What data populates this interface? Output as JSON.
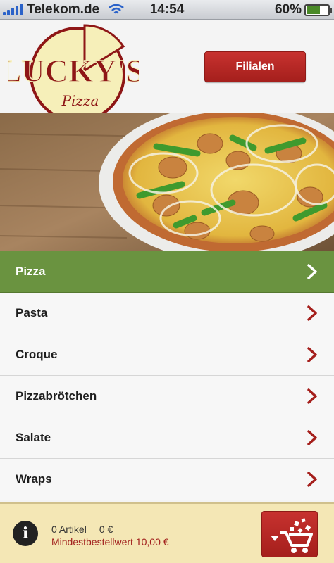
{
  "status_bar": {
    "carrier": "Telekom.de",
    "time": "14:54",
    "battery": "60%",
    "battery_level": 0.6,
    "signal_icon": "signal-bars-icon",
    "wifi_icon": "wifi-icon"
  },
  "header": {
    "logo_name": "LUCKY'S",
    "logo_sub": "Pizza",
    "filialen_label": "Filialen"
  },
  "menu": {
    "items": [
      {
        "label": "Pizza",
        "active": true
      },
      {
        "label": "Pasta",
        "active": false
      },
      {
        "label": "Croque",
        "active": false
      },
      {
        "label": "Pizzabrötchen",
        "active": false
      },
      {
        "label": "Salate",
        "active": false
      },
      {
        "label": "Wraps",
        "active": false
      }
    ]
  },
  "cart": {
    "articles": "0 Artikel",
    "total": "0 €",
    "minimum": "Mindestbestellwert 10,00 €"
  },
  "colors": {
    "brand_red": "#a51f1c",
    "active_green": "#6a9340",
    "cart_bg": "#f4e7b5"
  }
}
